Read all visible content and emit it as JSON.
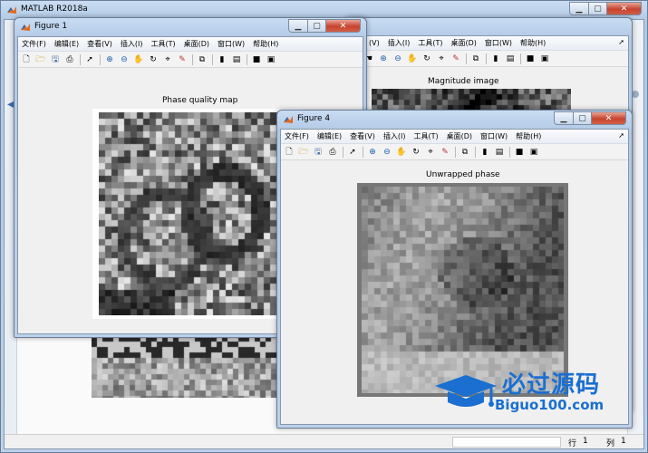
{
  "main_window": {
    "title": "MATLAB R2018a"
  },
  "fig1": {
    "title": "Figure 1",
    "plot_title": "Phase quality map"
  },
  "fig2": {
    "plot_title": "Magnitude image"
  },
  "fig4": {
    "title": "Figure 4",
    "plot_title": "Unwrapped phase"
  },
  "menu": {
    "file": "文件(F)",
    "edit": "编辑(E)",
    "view": "查看(V)",
    "insert": "插入(I)",
    "tools": "工具(T)",
    "desktop": "桌面(D)",
    "window": "窗口(W)",
    "help": "帮助(H)"
  },
  "menu_partial": [
    "(V)",
    "插入(I)",
    "工具(T)",
    "桌面(D)",
    "窗口(W)",
    "帮助(H)"
  ],
  "status": {
    "row_label": "行",
    "row_value": "1",
    "col_label": "列",
    "col_value": "1"
  },
  "watermark": {
    "brand": "必过源码",
    "url": "Biguo100.com"
  },
  "colors": {
    "accent_blue": "#1a6fd0",
    "close_red": "#c6432e"
  }
}
